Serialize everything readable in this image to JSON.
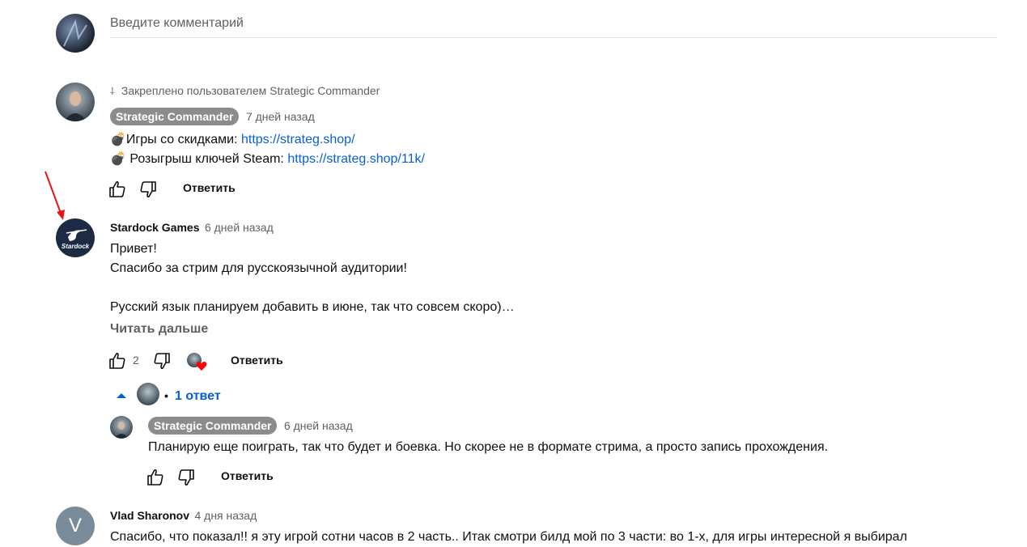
{
  "composer": {
    "placeholder": "Введите комментарий"
  },
  "pinned": {
    "pin_label": "Закреплено пользователем Strategic Commander",
    "author": "Strategic Commander",
    "time": "7 дней назад",
    "line1_prefix": "💣Игры со скидками: ",
    "line1_link": "https://strateg.shop/",
    "line2_prefix": "💣 Розыгрыш ключей Steam: ",
    "line2_link": "https://strateg.shop/11k/",
    "reply_label": "Ответить"
  },
  "comment2": {
    "author": "Stardock Games",
    "avatar_text": "Stardock",
    "time": "6 дней назад",
    "lines": [
      "Привет!",
      "Спасибо за стрим для русскоязычной аудитории!",
      "",
      "Русский язык планируем добавить в июне, так что совсем скоро)…"
    ],
    "read_more": "Читать дальше",
    "likes": "2",
    "reply_label": "Ответить",
    "replies_toggle": "1 ответ",
    "bullet": "•"
  },
  "reply": {
    "author": "Strategic Commander",
    "time": "6 дней назад",
    "text": "Планирую еще поиграть, так что будет и боевка. Но скорее не в формате стрима, а просто запись прохождения.",
    "reply_label": "Ответить"
  },
  "comment3": {
    "author": "Vlad Sharonov",
    "time": "4 дня назад",
    "avatar_letter": "V",
    "text": "Спасибо, что показал!! я эту игрой сотни часов в 2 часть.. Итак смотри билд мой по 3 части: во 1-х, для игры интересной я выбирал"
  },
  "colors": {
    "link": "#065fd4",
    "heart": "#ff0000",
    "arrow": "#e8141b"
  }
}
